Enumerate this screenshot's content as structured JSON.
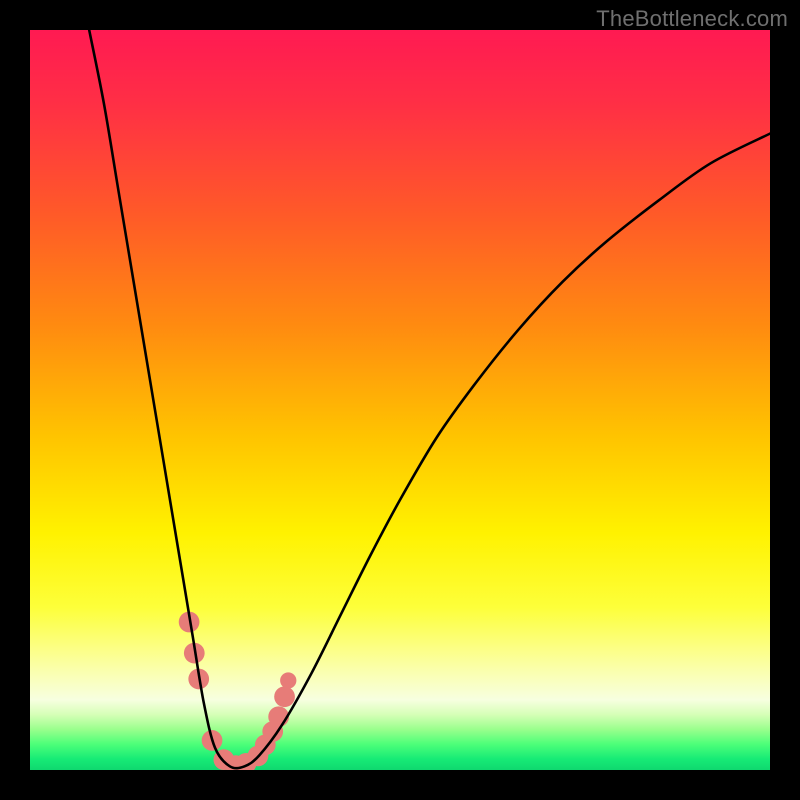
{
  "watermark": "TheBottleneck.com",
  "colors": {
    "frame": "#000000",
    "curve": "#000000",
    "marker": "#e77c78",
    "gradient_stops": [
      {
        "offset": 0.0,
        "color": "#ff1a52"
      },
      {
        "offset": 0.1,
        "color": "#ff2f45"
      },
      {
        "offset": 0.25,
        "color": "#ff5a28"
      },
      {
        "offset": 0.4,
        "color": "#ff8b10"
      },
      {
        "offset": 0.55,
        "color": "#ffc400"
      },
      {
        "offset": 0.68,
        "color": "#fff200"
      },
      {
        "offset": 0.78,
        "color": "#fdff3a"
      },
      {
        "offset": 0.86,
        "color": "#fbffa6"
      },
      {
        "offset": 0.905,
        "color": "#f7ffe0"
      },
      {
        "offset": 0.925,
        "color": "#d6ffb7"
      },
      {
        "offset": 0.945,
        "color": "#9aff8d"
      },
      {
        "offset": 0.965,
        "color": "#4dff79"
      },
      {
        "offset": 0.985,
        "color": "#17eb76"
      },
      {
        "offset": 1.0,
        "color": "#0fd86f"
      }
    ]
  },
  "chart_data": {
    "type": "line",
    "title": "",
    "xlabel": "",
    "ylabel": "",
    "xlim": [
      0,
      100
    ],
    "ylim": [
      0,
      100
    ],
    "series": [
      {
        "name": "bottleneck-curve",
        "x": [
          8,
          10,
          12,
          14,
          16,
          18,
          20,
          22,
          23.5,
          25,
          27,
          29,
          31,
          34,
          38,
          42,
          46,
          50,
          55,
          60,
          66,
          72,
          78,
          85,
          92,
          100
        ],
        "y": [
          100,
          90,
          78,
          66,
          54,
          42,
          30,
          18,
          9,
          3,
          0.5,
          0.5,
          2,
          6,
          13,
          21,
          29,
          36.5,
          45,
          52,
          59.5,
          66,
          71.5,
          77,
          82,
          86
        ]
      }
    ],
    "markers": [
      {
        "x": 21.5,
        "y": 20.0,
        "r": 1.4
      },
      {
        "x": 22.2,
        "y": 15.8,
        "r": 1.4
      },
      {
        "x": 22.8,
        "y": 12.3,
        "r": 1.4
      },
      {
        "x": 24.6,
        "y": 4.0,
        "r": 1.4
      },
      {
        "x": 26.2,
        "y": 1.4,
        "r": 1.4
      },
      {
        "x": 27.8,
        "y": 0.6,
        "r": 1.4
      },
      {
        "x": 29.2,
        "y": 0.9,
        "r": 1.4
      },
      {
        "x": 30.8,
        "y": 1.9,
        "r": 1.4
      },
      {
        "x": 31.8,
        "y": 3.4,
        "r": 1.4
      },
      {
        "x": 32.8,
        "y": 5.2,
        "r": 1.4
      },
      {
        "x": 33.6,
        "y": 7.2,
        "r": 1.4
      },
      {
        "x": 34.4,
        "y": 9.9,
        "r": 1.4
      },
      {
        "x": 34.9,
        "y": 12.1,
        "r": 1.1
      }
    ]
  }
}
